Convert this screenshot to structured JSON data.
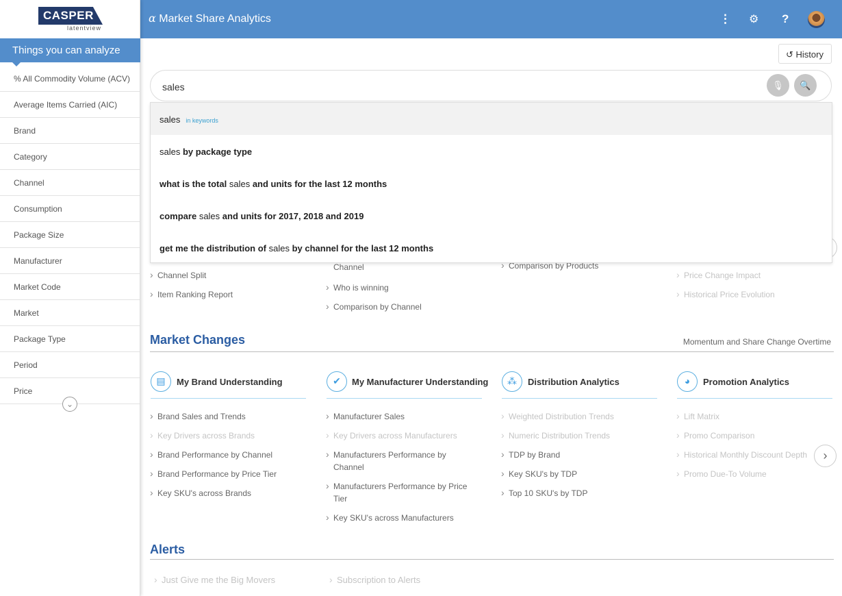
{
  "logo": {
    "brand": "CASPER",
    "sub": "latentview"
  },
  "sidebar": {
    "heading": "Things you can analyze",
    "items": [
      "% All Commodity Volume (ACV)",
      "Average Items Carried (AIC)",
      "Brand",
      "Category",
      "Channel",
      "Consumption",
      "Package Size",
      "Manufacturer",
      "Market Code",
      "Market",
      "Package Type",
      "Period",
      "Price"
    ]
  },
  "header": {
    "title": "Market Share Analytics",
    "alpha": "α",
    "menu_icon": "⋮",
    "settings_icon": "⚙",
    "help_icon": "?"
  },
  "history": {
    "label": "History",
    "icon": "↺"
  },
  "search": {
    "value": "sales"
  },
  "suggestions": [
    {
      "pre": "",
      "kw": "sales",
      "post": "",
      "tag": "in keywords"
    },
    {
      "pre": "",
      "kw": "sales",
      "post": " by package type"
    },
    {
      "pre": "what is the total ",
      "kw": "sales",
      "post": " and units for the last 12 months"
    },
    {
      "pre": "compare ",
      "kw": "sales",
      "post": " and units for 2017, 2018 and 2019"
    },
    {
      "pre": "get me the distribution of ",
      "kw": "sales",
      "post": " by channel for the last 12 months"
    }
  ],
  "top_section": {
    "col1": [
      "Channel Split",
      "Item Ranking Report"
    ],
    "col2_cont": "Channel",
    "col2": [
      "Who is winning",
      "Comparison by Channel"
    ],
    "col3": [
      "Comparison by Products"
    ],
    "col4": [
      "Price Change Impact",
      "Historical Price Evolution"
    ]
  },
  "market_changes": {
    "title": "Market Changes",
    "subtitle": "Momentum and Share Change Overtime",
    "cards": [
      {
        "title": "My Brand Understanding",
        "links": [
          "Brand Sales and Trends",
          "Key Drivers across Brands",
          "Brand Performance by Channel",
          "Brand Performance by Price Tier",
          "Key SKU's across Brands"
        ]
      },
      {
        "title": "My Manufacturer Understanding",
        "links": [
          "Manufacturer Sales",
          "Key Drivers across Manufacturers",
          "Manufacturers Performance by Channel",
          "Manufacturers Performance by Price Tier",
          "Key SKU's across Manufacturers"
        ]
      },
      {
        "title": "Distribution Analytics",
        "links": [
          "Weighted Distribution Trends",
          "Numeric Distribution Trends",
          "TDP by Brand",
          "Key SKU's by TDP",
          "Top 10 SKU's by TDP"
        ]
      },
      {
        "title": "Promotion Analytics",
        "links": [
          "Lift Matrix",
          "Promo Comparison",
          "Historical Monthly Discount Depth",
          "Promo Due-To Volume"
        ]
      }
    ]
  },
  "alerts": {
    "title": "Alerts",
    "links": [
      "Just Give me the Big Movers",
      "Subscription to Alerts"
    ]
  }
}
